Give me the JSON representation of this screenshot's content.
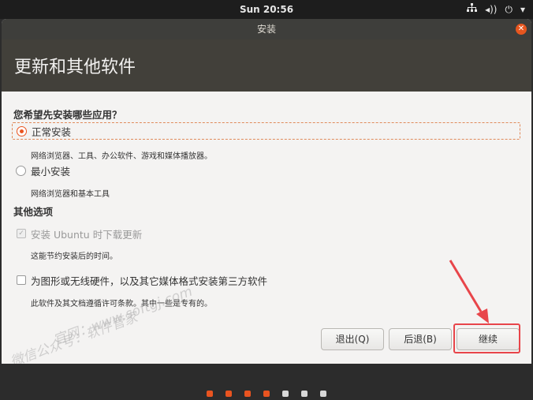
{
  "topbar": {
    "clock": "Sun 20:56",
    "icons": [
      "network-icon",
      "volume-icon",
      "power-icon",
      "chevron-down-icon"
    ]
  },
  "window": {
    "title": "安装",
    "header": "更新和其他软件"
  },
  "question": "您希望先安装哪些应用？",
  "options": [
    {
      "label": "正常安装",
      "desc": "网络浏览器、工具、办公软件、游戏和媒体播放器。",
      "selected": true
    },
    {
      "label": "最小安装",
      "desc": "网络浏览器和基本工具",
      "selected": false
    }
  ],
  "other_title": "其他选项",
  "other_options": [
    {
      "label": "安装 Ubuntu 时下载更新",
      "desc": "这能节约安装后的时间。",
      "checked": true,
      "disabled": true
    },
    {
      "label": "为图形或无线硬件，以及其它媒体格式安装第三方软件",
      "desc": "此软件及其文档遵循许可条款。其中一些是专有的。",
      "checked": false,
      "disabled": false
    }
  ],
  "buttons": {
    "quit": "退出(Q)",
    "back": "后退(B)",
    "continue": "继续"
  },
  "watermark": {
    "line1": "微信公众号：软件管家",
    "line2": "官网：www.softgj.com"
  },
  "progress": {
    "steps": 7,
    "done": 4,
    "active_color": "#e95420",
    "pending_color": "#d8d8d8"
  },
  "colors": {
    "accent": "#e95420",
    "annotation": "#e8454a"
  }
}
